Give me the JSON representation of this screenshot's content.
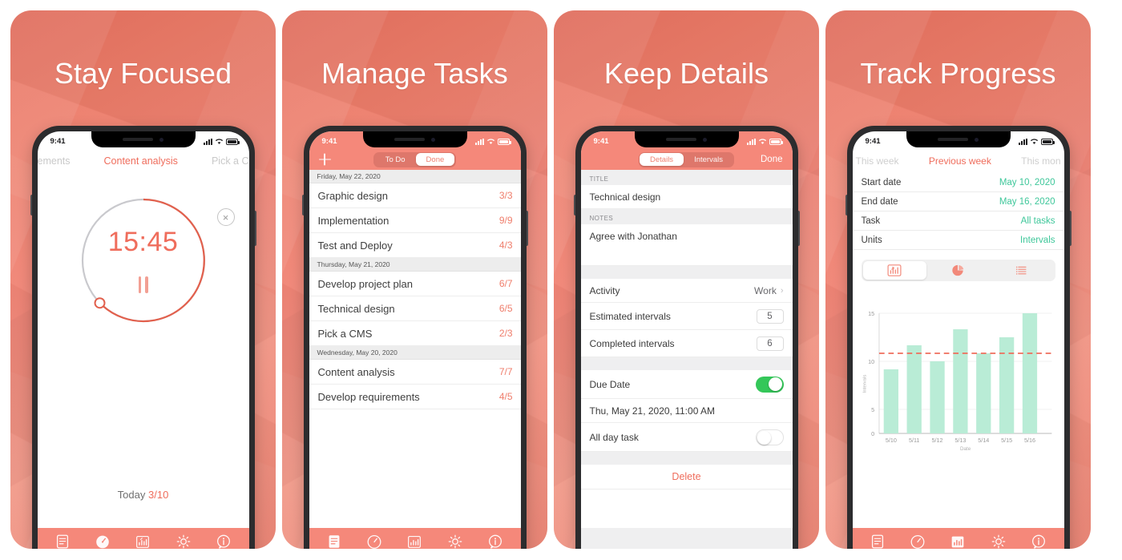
{
  "accent": "#ef6d5c",
  "accent_bar": "#f5887a",
  "green": "#3ec79a",
  "bar_fill": "#b9ecd6",
  "panels": [
    {
      "headline": "Stay Focused",
      "status": {
        "time": "9:41"
      },
      "tasks_strip": {
        "left": "ements",
        "center": "Content analysis",
        "right": "Pick a C"
      },
      "close_icon": "×",
      "timer": {
        "value": "15:45",
        "progress_pct": 72
      },
      "today": {
        "label": "Today",
        "value": "3/10"
      },
      "tabbar": {
        "active": "timer",
        "items": [
          "list-icon",
          "timer-icon",
          "chart-icon",
          "gear-icon",
          "info-icon"
        ]
      }
    },
    {
      "headline": "Manage Tasks",
      "status": {
        "time": "9:41"
      },
      "nav": {
        "add_label": "+",
        "segments": [
          "To Do",
          "Done"
        ],
        "active_segment": "Done"
      },
      "groups": [
        {
          "date": "Friday, May 22, 2020",
          "tasks": [
            {
              "title": "Graphic design",
              "count": "3/3"
            },
            {
              "title": "Implementation",
              "count": "9/9"
            },
            {
              "title": "Test and Deploy",
              "count": "4/3"
            }
          ]
        },
        {
          "date": "Thursday, May 21, 2020",
          "tasks": [
            {
              "title": "Develop project plan",
              "count": "6/7"
            },
            {
              "title": "Technical design",
              "count": "6/5"
            },
            {
              "title": "Pick a CMS",
              "count": "2/3"
            }
          ]
        },
        {
          "date": "Wednesday, May 20, 2020",
          "tasks": [
            {
              "title": "Content analysis",
              "count": "7/7"
            },
            {
              "title": "Develop requirements",
              "count": "4/5"
            }
          ]
        }
      ],
      "tabbar": {
        "active": "list",
        "items": [
          "list-icon",
          "timer-icon",
          "chart-icon",
          "gear-icon",
          "info-icon"
        ]
      }
    },
    {
      "headline": "Keep Details",
      "status": {
        "time": "9:41"
      },
      "nav": {
        "segments": [
          "Details",
          "Intervals"
        ],
        "active_segment": "Details",
        "done_label": "Done"
      },
      "title_header": "TITLE",
      "title_value": "Technical design",
      "notes_header": "NOTES",
      "notes_value": "Agree with Jonathan",
      "fields": [
        {
          "label": "Activity",
          "value": "Work",
          "type": "chevron"
        },
        {
          "label": "Estimated intervals",
          "value": "5",
          "type": "stepper"
        },
        {
          "label": "Completed intervals",
          "value": "6",
          "type": "stepper"
        }
      ],
      "due": {
        "label": "Due Date",
        "toggle": "on",
        "date_value": "Thu, May 21, 2020, 11:00 AM",
        "allday_label": "All day task",
        "allday_toggle": "off"
      },
      "delete_label": "Delete",
      "tabbar": {
        "active": "none",
        "items": []
      }
    },
    {
      "headline": "Track Progress",
      "status": {
        "time": "9:41"
      },
      "period_tabs": {
        "left": "This week",
        "center": "Previous week",
        "right": "This mon",
        "active": "Previous week"
      },
      "summary": [
        {
          "label": "Start date",
          "value": "May 10, 2020"
        },
        {
          "label": "End date",
          "value": "May 16, 2020"
        },
        {
          "label": "Task",
          "value": "All tasks"
        },
        {
          "label": "Units",
          "value": "Intervals"
        }
      ],
      "chart_modes": [
        "bar-chart-icon",
        "pie-chart-icon",
        "list-icon"
      ],
      "chart_mode_active": "bar-chart-icon",
      "tabbar": {
        "active": "chart",
        "items": [
          "list-icon",
          "timer-icon",
          "chart-icon",
          "gear-icon",
          "info-icon"
        ]
      }
    }
  ],
  "chart_data": {
    "type": "bar",
    "title": "",
    "xlabel": "Date",
    "ylabel": "Intervals",
    "categories": [
      "5/10",
      "5/11",
      "5/12",
      "5/13",
      "5/14",
      "5/15",
      "5/16"
    ],
    "values": [
      8,
      11,
      9,
      13,
      10,
      12,
      15
    ],
    "yticks": [
      0,
      5,
      10,
      15
    ],
    "ylim": [
      0,
      15
    ],
    "grid": true,
    "legend": "none",
    "target_line": {
      "value": 10,
      "style": "dashed",
      "color": "#ef6d5c"
    },
    "bar_color": "#b9ecd6"
  }
}
